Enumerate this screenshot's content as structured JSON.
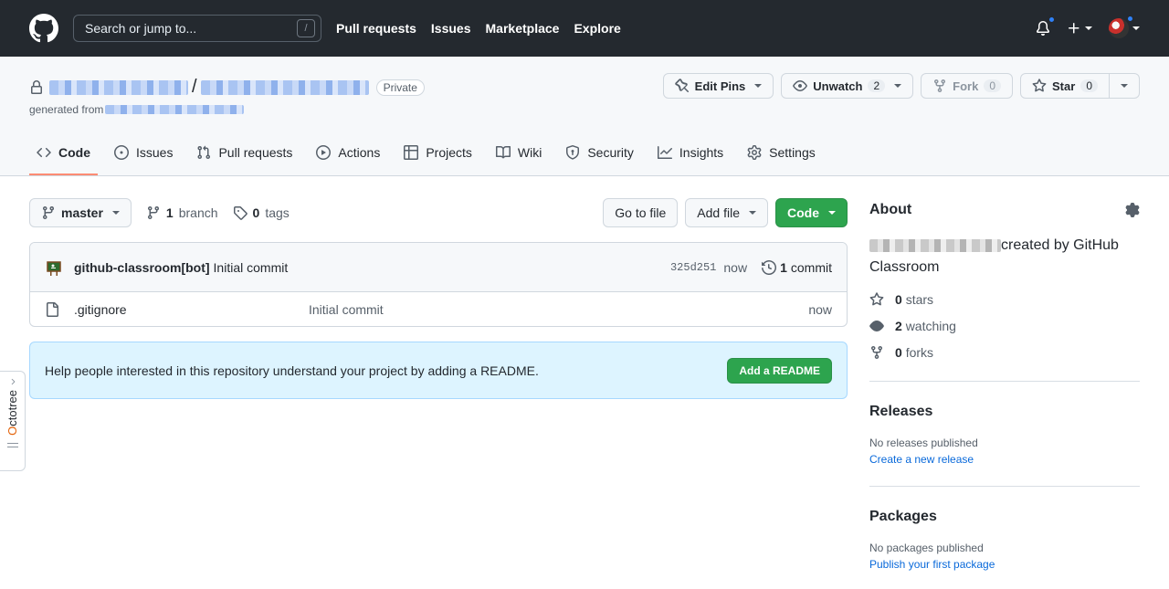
{
  "header": {
    "search_placeholder": "Search or jump to...",
    "search_shortcut": "/",
    "nav": [
      "Pull requests",
      "Issues",
      "Marketplace",
      "Explore"
    ]
  },
  "repo": {
    "owner": "",
    "name": "",
    "visibility": "Private",
    "generated_from_label": "generated from",
    "actions": {
      "edit_pins": "Edit Pins",
      "unwatch": "Unwatch",
      "unwatch_count": "2",
      "fork": "Fork",
      "fork_count": "0",
      "star": "Star",
      "star_count": "0"
    },
    "tabs": [
      {
        "label": "Code",
        "icon": "code-icon"
      },
      {
        "label": "Issues",
        "icon": "issue-icon"
      },
      {
        "label": "Pull requests",
        "icon": "pull-request-icon"
      },
      {
        "label": "Actions",
        "icon": "play-icon"
      },
      {
        "label": "Projects",
        "icon": "table-icon"
      },
      {
        "label": "Wiki",
        "icon": "book-icon"
      },
      {
        "label": "Security",
        "icon": "shield-icon"
      },
      {
        "label": "Insights",
        "icon": "graph-icon"
      },
      {
        "label": "Settings",
        "icon": "gear-icon"
      }
    ]
  },
  "toolbar": {
    "branch": "master",
    "branch_count": "1",
    "branch_label": "branch",
    "tag_count": "0",
    "tag_label": "tags",
    "go_to_file": "Go to file",
    "add_file": "Add file",
    "code": "Code"
  },
  "latest_commit": {
    "author": "github-classroom[bot]",
    "message": "Initial commit",
    "sha": "325d251",
    "age": "now",
    "commit_count": "1",
    "commit_label": "commit"
  },
  "files": [
    {
      "name": ".gitignore",
      "message": "Initial commit",
      "age": "now"
    }
  ],
  "readme_banner": {
    "text": "Help people interested in this repository understand your project by adding a README.",
    "button": "Add a README"
  },
  "about": {
    "title": "About",
    "description_suffix": "created by GitHub Classroom",
    "stars_count": "0",
    "stars_label": "stars",
    "watching_count": "2",
    "watching_label": "watching",
    "forks_count": "0",
    "forks_label": "forks"
  },
  "releases": {
    "title": "Releases",
    "empty": "No releases published",
    "link": "Create a new release"
  },
  "packages": {
    "title": "Packages",
    "empty": "No packages published",
    "link": "Publish your first package"
  },
  "octotree": {
    "label_prefix": "O",
    "label_rest": "ctotree"
  },
  "colors": {
    "accent_green": "#2da44e",
    "link": "#0969da",
    "header_bg": "#24292f",
    "active_tab": "#fd8c73"
  }
}
